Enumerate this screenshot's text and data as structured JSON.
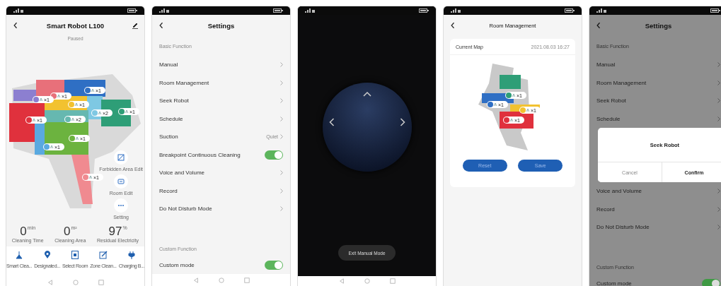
{
  "screens": [
    {
      "kind": "home",
      "title": "Smart Robot L100",
      "status": "Paused",
      "rooms": [
        {
          "color": "#e8707a",
          "count": "×1"
        },
        {
          "color": "#2f6fc4",
          "count": "×1"
        },
        {
          "color": "#8c7fd0",
          "count": "×1"
        },
        {
          "color": "#f2c230",
          "count": "×1"
        },
        {
          "color": "#7ec8e3",
          "count": "×2"
        },
        {
          "color": "#2e9e77",
          "count": "×1"
        },
        {
          "color": "#e0313d",
          "count": "×1"
        },
        {
          "color": "#66b8b0",
          "count": "×2"
        },
        {
          "color": "#5aa9e0",
          "count": "×1"
        },
        {
          "color": "#6cb33f",
          "count": "×1"
        },
        {
          "color": "#f08a90",
          "count": "×1"
        }
      ],
      "tools": [
        {
          "kind": "forbidden",
          "label": "Forbidden Area Edit"
        },
        {
          "kind": "room",
          "label": "Room Edit"
        },
        {
          "kind": "more",
          "label": "Setting"
        }
      ],
      "stats": [
        {
          "value": "0",
          "unit": "min",
          "label": "Cleaning Time"
        },
        {
          "value": "0",
          "unit": "m²",
          "label": "Cleaning Area"
        },
        {
          "value": "97",
          "unit": "%",
          "label": "Residual Electricity"
        }
      ],
      "modes": [
        {
          "kind": "smart",
          "label": "Smart Clea..."
        },
        {
          "kind": "spot",
          "label": "Designated..."
        },
        {
          "kind": "room",
          "label": "Select Room"
        },
        {
          "kind": "zone",
          "label": "Zone Clean..."
        },
        {
          "kind": "charge",
          "label": "Charging B..."
        }
      ]
    },
    {
      "kind": "settings",
      "title": "Settings",
      "dimmed": false,
      "sections": [
        {
          "heading": "Basic Function",
          "items": [
            {
              "kind": "link",
              "label": "Manual"
            },
            {
              "kind": "link",
              "label": "Room Management"
            },
            {
              "kind": "link",
              "label": "Seek Robot"
            },
            {
              "kind": "link",
              "label": "Schedule"
            },
            {
              "kind": "value",
              "label": "Suction",
              "value": "Quiet"
            },
            {
              "kind": "toggle",
              "label": "Breakpoint Continuous Cleaning",
              "on": true
            },
            {
              "kind": "link",
              "label": "Voice and Volume"
            },
            {
              "kind": "link",
              "label": "Record"
            },
            {
              "kind": "link",
              "label": "Do Not Disturb Mode"
            }
          ]
        },
        {
          "heading": "Custom Function",
          "items": [
            {
              "kind": "toggle",
              "label": "Custom mode",
              "on": true
            }
          ]
        }
      ]
    },
    {
      "kind": "manual",
      "button": "Exit Manual Mode"
    },
    {
      "kind": "rooms",
      "title": "Room Management",
      "card_title": "Current Map",
      "timestamp": "2021.08.03 16:27",
      "rooms": [
        {
          "color": "#2e9e77",
          "count": "×1"
        },
        {
          "color": "#2f6fc4",
          "count": "×1"
        },
        {
          "color": "#f2c230",
          "count": "×1"
        },
        {
          "color": "#e0313d",
          "count": "×1"
        }
      ],
      "buttons": [
        "Reset",
        "Save"
      ]
    },
    {
      "kind": "settings",
      "title": "Settings",
      "dimmed": true,
      "sections": [
        {
          "heading": "Basic Function",
          "items": [
            {
              "kind": "link",
              "label": "Manual"
            },
            {
              "kind": "link",
              "label": "Room Management"
            },
            {
              "kind": "link",
              "label": "Seek Robot"
            },
            {
              "kind": "link",
              "label": "Schedule"
            },
            {
              "kind": "dialog",
              "title": "Seek Robot",
              "buttons": [
                "Cancel",
                "Confirm"
              ]
            },
            {
              "kind": "link",
              "label": "Voice and Volume"
            },
            {
              "kind": "link",
              "label": "Record"
            },
            {
              "kind": "link",
              "label": "Do Not Disturb Mode"
            }
          ]
        },
        {
          "heading": "Custom Function",
          "items": [
            {
              "kind": "toggle",
              "label": "Custom mode",
              "on": true
            }
          ]
        }
      ]
    }
  ]
}
